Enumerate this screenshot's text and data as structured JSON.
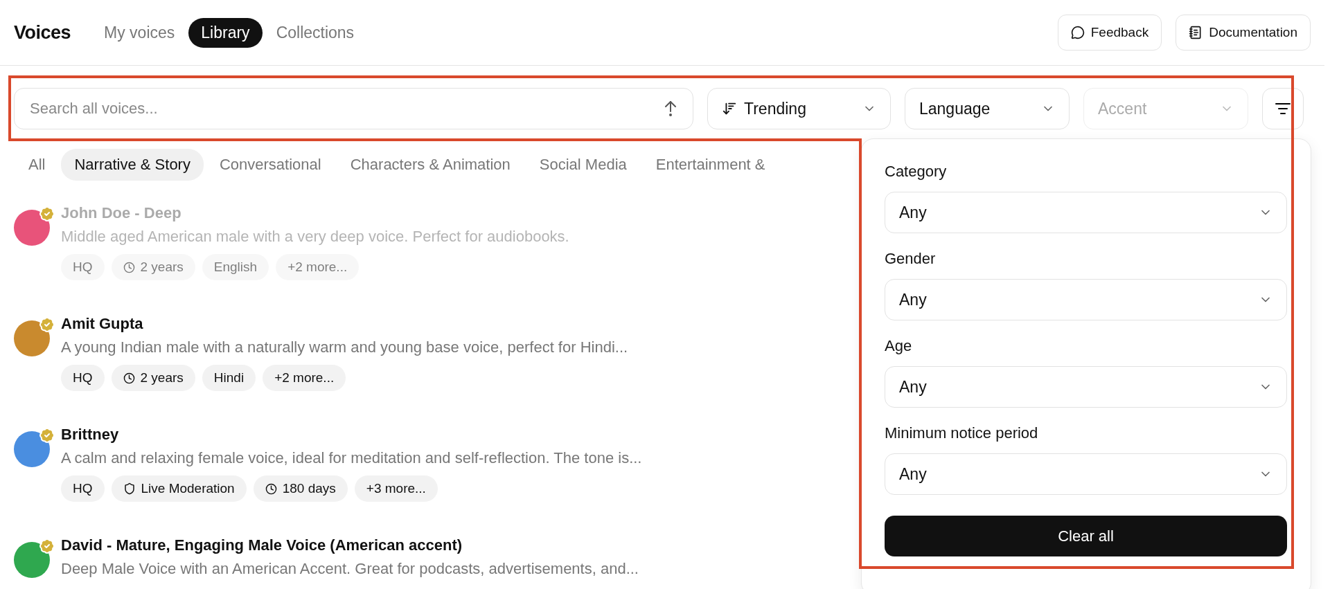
{
  "header": {
    "title": "Voices",
    "tabs": [
      {
        "label": "My voices",
        "selected": false
      },
      {
        "label": "Library",
        "selected": true
      },
      {
        "label": "Collections",
        "selected": false
      }
    ],
    "feedback_button": "Feedback",
    "documentation_button": "Documentation"
  },
  "toolbar": {
    "search_placeholder": "Search all voices...",
    "dropdowns": [
      {
        "label": "Trending",
        "kind": "sort",
        "disabled": false
      },
      {
        "label": "Language",
        "kind": "plain",
        "disabled": false
      },
      {
        "label": "Accent",
        "kind": "plain",
        "disabled": true
      }
    ]
  },
  "categories": [
    {
      "label": "All",
      "selected": false
    },
    {
      "label": "Narrative & Story",
      "selected": true
    },
    {
      "label": "Conversational",
      "selected": false
    },
    {
      "label": "Characters & Animation",
      "selected": false
    },
    {
      "label": "Social Media",
      "selected": false
    },
    {
      "label": "Entertainment &",
      "selected": false
    }
  ],
  "voices": [
    {
      "name": "John Doe - Deep",
      "description": "Middle aged American male with a very deep voice. Perfect for audiobooks.",
      "faded": true,
      "color": "#e8537a",
      "tags": [
        {
          "kind": "text",
          "label": "HQ"
        },
        {
          "kind": "duration",
          "label": "2 years"
        },
        {
          "kind": "text",
          "label": "English"
        },
        {
          "kind": "text",
          "label": "+2 more..."
        }
      ]
    },
    {
      "name": "Amit Gupta",
      "description": "A young Indian male with a naturally warm and young base voice, perfect for Hindi...",
      "faded": false,
      "color": "#c98a2e",
      "tags": [
        {
          "kind": "text",
          "label": "HQ"
        },
        {
          "kind": "duration",
          "label": "2 years"
        },
        {
          "kind": "text",
          "label": "Hindi"
        },
        {
          "kind": "text",
          "label": "+2 more..."
        }
      ]
    },
    {
      "name": "Brittney",
      "description": "A calm and relaxing female voice, ideal for meditation and self-reflection. The tone is...",
      "faded": false,
      "color": "#4a8ee0",
      "tags": [
        {
          "kind": "text",
          "label": "HQ"
        },
        {
          "kind": "moderation",
          "label": "Live Moderation"
        },
        {
          "kind": "duration",
          "label": "180 days"
        },
        {
          "kind": "text",
          "label": "+3 more..."
        }
      ]
    },
    {
      "name": "David - Mature, Engaging Male Voice (American accent)",
      "description": "Deep Male Voice with an American Accent. Great for podcasts, advertisements, and...",
      "faded": false,
      "color": "#2fa84f"
    }
  ],
  "filter_panel": {
    "filters": [
      {
        "label": "Category",
        "value": "Any"
      },
      {
        "label": "Gender",
        "value": "Any"
      },
      {
        "label": "Age",
        "value": "Any"
      },
      {
        "label": "Minimum notice period",
        "value": "Any"
      }
    ],
    "clear_button": "Clear all"
  },
  "highlight_outline": true
}
